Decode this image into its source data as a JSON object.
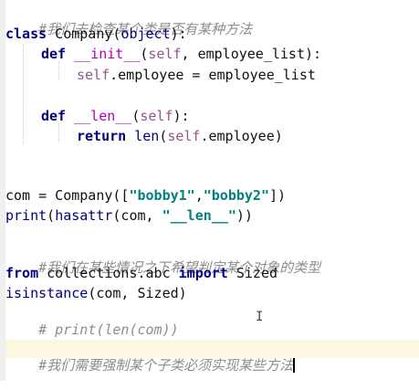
{
  "code": {
    "comment1": "#我们去检查某个类是否有某种方法",
    "l2_kw": "class",
    "l2_rest": " Company(",
    "l2_base": "object",
    "l2_end": "):",
    "l3_kw": "def",
    "l3_name": "__init__",
    "l3_open": "(",
    "l3_self": "self",
    "l3_rest": ", employee_list):",
    "l4_self": "self",
    "l4_rest": ".employee = employee_list",
    "l5_kw": "def",
    "l5_name": "__len__",
    "l5_open": "(",
    "l5_self": "self",
    "l5_end": "):",
    "l6_kw": "return",
    "l6_len": "len",
    "l6_open": "(",
    "l6_self": "self",
    "l6_end": ".employee)",
    "l7_a": "com = Company([",
    "l7_s1": "\"bobby1\"",
    "l7_comma": ",",
    "l7_s2": "\"bobby2\"",
    "l7_end": "])",
    "l8_print": "print",
    "l8_a": "(",
    "l8_hasattr": "hasattr",
    "l8_b": "(com, ",
    "l8_str": "\"__len__\"",
    "l8_end": "))",
    "comment2": "#我们在某些情况之下希望判定某个对象的类型",
    "l10_from": "from",
    "l10_mod": " collections.abc ",
    "l10_import": "import",
    "l10_name": " Sized",
    "l11_isinstance": "isinstance",
    "l11_rest": "(com, Sized)",
    "comment3": "# print(len(com))",
    "comment4": "#我们需要强制某个子类必须实现某些方法"
  }
}
